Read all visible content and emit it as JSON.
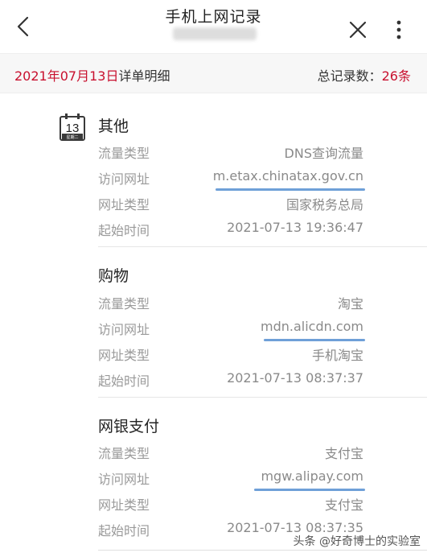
{
  "navbar": {
    "title": "手机上网记录",
    "back_icon": "chevron-left-icon",
    "close_icon": "close-icon",
    "more_icon": "more-vertical-icon"
  },
  "summary": {
    "date": "2021年07月13日",
    "detail_label": "详单明细",
    "total_label": "总记录数：",
    "total_count": "26",
    "total_unit": "条",
    "accent_color": "#c8102e"
  },
  "calendar_icon": {
    "day": "13",
    "weekday": "星期二"
  },
  "groups": [
    {
      "title": "其他",
      "rows": [
        {
          "label": "流量类型",
          "value": "DNS查询流量"
        },
        {
          "label": "访问网址",
          "value": "m.etax.chinatax.gov.cn"
        },
        {
          "label": "网址类型",
          "value": "国家税务总局"
        },
        {
          "label": "起始时间",
          "value": "2021-07-13 19:36:47"
        }
      ]
    },
    {
      "title": "购物",
      "rows": [
        {
          "label": "流量类型",
          "value": "淘宝"
        },
        {
          "label": "访问网址",
          "value": "mdn.alicdn.com"
        },
        {
          "label": "网址类型",
          "value": "手机淘宝"
        },
        {
          "label": "起始时间",
          "value": "2021-07-13 08:37:37"
        }
      ]
    },
    {
      "title": "网银支付",
      "rows": [
        {
          "label": "流量类型",
          "value": "支付宝"
        },
        {
          "label": "访问网址",
          "value": "mgw.alipay.com"
        },
        {
          "label": "网址类型",
          "value": "支付宝"
        },
        {
          "label": "起始时间",
          "value": "2021-07-13 08:37:35"
        }
      ]
    }
  ],
  "watermark": "头条 @好奇博士的实验室",
  "highlight_color": "#6fa0d8"
}
